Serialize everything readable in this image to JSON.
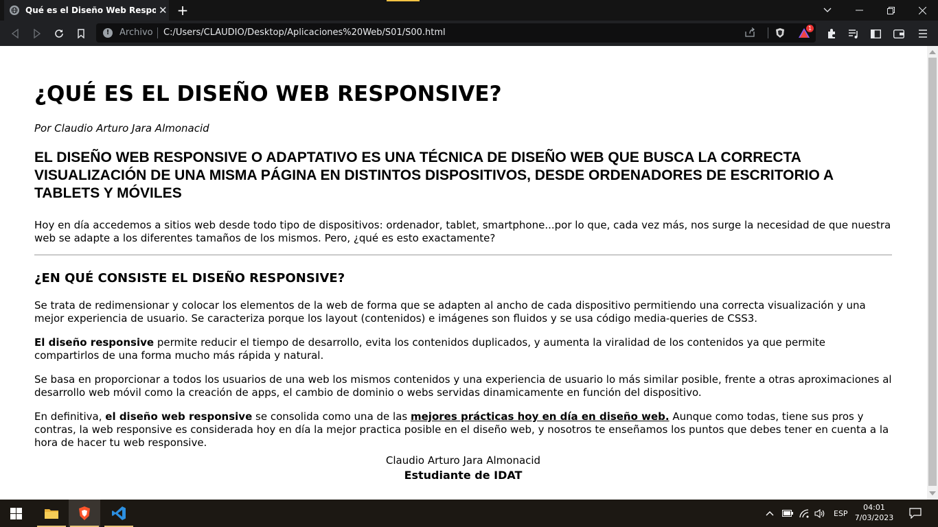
{
  "browser": {
    "tab_title": "Qué es el Diseño Web Responsive",
    "tab_close": "✕",
    "new_tab": "+",
    "address_scheme": "Archivo",
    "address_url": "C:/Users/CLAUDIO/Desktop/Aplicaciones%20Web/S01/S00.html",
    "rewards_badge": "1"
  },
  "page": {
    "title": "¿QUÉ ES EL DISEÑO WEB RESPONSIVE?",
    "author": "Por Claudio Arturo Jara Almonacid",
    "lead": "EL DISEÑO WEB RESPONSIVE O ADAPTATIVO ES UNA TÉCNICA DE DISEÑO WEB QUE BUSCA LA CORRECTA VISUALIZACIÓN DE UNA MISMA PÁGINA EN DISTINTOS DISPOSITIVOS, DESDE ORDENADORES DE ESCRITORIO A TABLETS Y MÓVILES",
    "intro": "Hoy en día accedemos a sitios web desde todo tipo de dispositivos: ordenador, tablet, smartphone...por lo que, cada vez más, nos surge la necesidad de que nuestra web se adapte a los diferentes tamaños de los mismos. Pero, ¿qué es esto exactamente?",
    "section_heading": "¿EN QUÉ CONSISTE EL DISEÑO RESPONSIVE?",
    "para1": "Se trata de redimensionar y colocar los elementos de la web de forma que se adapten al ancho de cada dispositivo permitiendo una correcta visualización y una mejor experiencia de usuario. Se caracteriza porque los layout (contenidos) e imágenes son fluidos y se usa código media-queries de CSS3.",
    "para2_bold": "El diseño responsive",
    "para2_rest": " permite reducir el tiempo de desarrollo, evita los contenidos duplicados, y aumenta la viralidad de los contenidos ya que permite compartirlos de una forma mucho más rápida y natural.",
    "para3": "Se basa en proporcionar a todos los usuarios de una web los mismos contenidos y una experiencia de usuario lo más similar posible, frente a otras aproximaciones al desarrollo web móvil como la creación de apps, el cambio de dominio o webs servidas dinamicamente en función del dispositivo.",
    "para4_a": "En definitiva, ",
    "para4_bold": "el diseño web responsive",
    "para4_b": " se consolida como una de las ",
    "para4_link": "mejores prácticas hoy en día en diseño web.",
    "para4_c": " Aunque como todas, tiene sus pros y contras, la web responsive es considerada hoy en día la mejor practica posible en el diseño web, y nosotros te enseñamos los puntos que debes tener en cuenta a la hora de hacer tu web responsive.",
    "footer_name": "Claudio Arturo Jara Almonacid",
    "footer_role": "Estudiante de IDAT"
  },
  "taskbar": {
    "language": "ESP",
    "time": "04:01",
    "date": "7/03/2023"
  }
}
